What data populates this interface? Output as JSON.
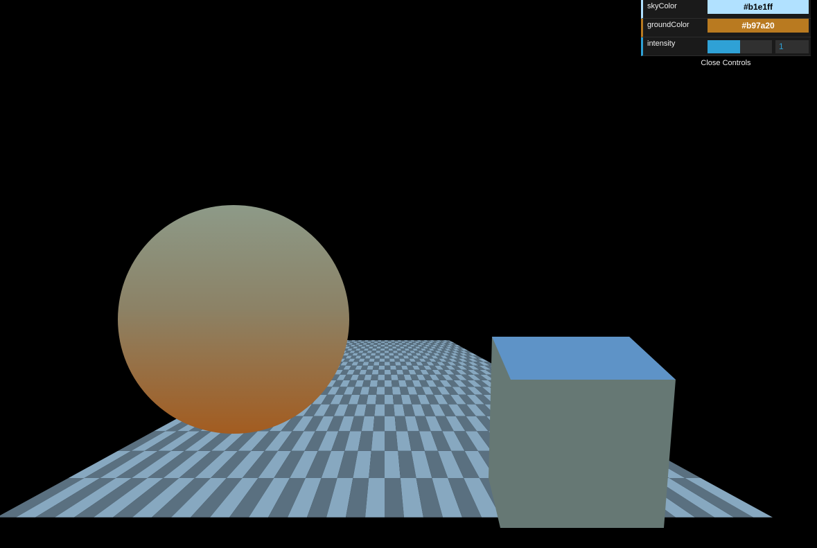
{
  "controls": {
    "sky_color_label": "skyColor",
    "sky_color_value": "#b1e1ff",
    "ground_color_label": "groundColor",
    "ground_color_value": "#b97a20",
    "intensity_label": "intensity",
    "intensity_value": "1",
    "intensity_fraction": 0.5,
    "close_label": "Close Controls"
  },
  "scene": {
    "objects": [
      "checkerboard-ground-plane",
      "sphere",
      "cube"
    ],
    "checker_light": "#87a8c0",
    "checker_dark": "#5a7080",
    "sphere_top_color": "#8d9a88",
    "sphere_bottom_color": "#a35c20",
    "cube_top_color": "#5e93c7",
    "cube_side_color": "#667874"
  }
}
